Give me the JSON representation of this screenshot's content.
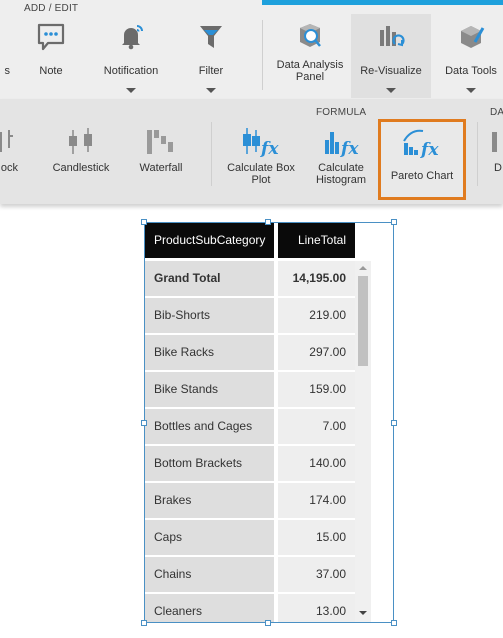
{
  "ribbon": {
    "group_add_edit": "ADD / EDIT",
    "group_formula": "FORMULA",
    "group_truncated": "DA",
    "accent_color": "#1ea0dc",
    "top_buttons": [
      {
        "label": "s"
      },
      {
        "label": "Note"
      },
      {
        "label": "Notification"
      },
      {
        "label": "Filter"
      },
      {
        "label": "Data Analysis\nPanel"
      },
      {
        "label": "Re-Visualize"
      },
      {
        "label": "Data Tools"
      }
    ],
    "bottom_buttons": [
      {
        "label": "ock"
      },
      {
        "label": "Candlestick"
      },
      {
        "label": "Waterfall"
      },
      {
        "label": "Calculate Box\nPlot"
      },
      {
        "label": "Calculate\nHistogram"
      },
      {
        "label": "Pareto Chart"
      },
      {
        "label": "D"
      }
    ],
    "highlight_color": "#e07b1f"
  },
  "grid": {
    "columns": [
      "ProductSubCategory",
      "LineTotal"
    ],
    "grand_total": {
      "label": "Grand Total",
      "value": "14,195.00"
    },
    "rows": [
      {
        "category": "Bib-Shorts",
        "value": "219.00"
      },
      {
        "category": "Bike Racks",
        "value": "297.00"
      },
      {
        "category": "Bike Stands",
        "value": "159.00"
      },
      {
        "category": "Bottles and Cages",
        "value": "7.00"
      },
      {
        "category": "Bottom Brackets",
        "value": "140.00"
      },
      {
        "category": "Brakes",
        "value": "174.00"
      },
      {
        "category": "Caps",
        "value": "15.00"
      },
      {
        "category": "Chains",
        "value": "37.00"
      },
      {
        "category": "Cleaners",
        "value": "13.00"
      }
    ]
  }
}
